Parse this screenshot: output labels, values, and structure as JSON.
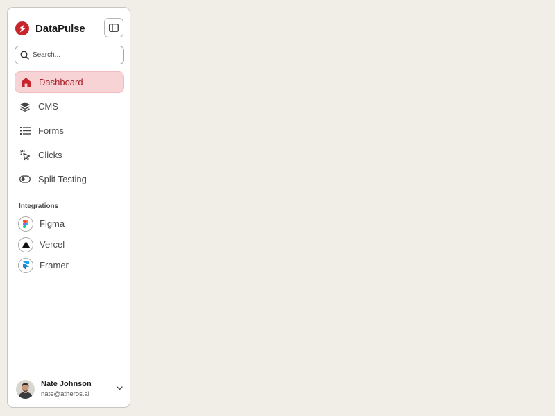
{
  "brand": {
    "name": "DataPulse",
    "logo_icon": "bolt-icon",
    "accent_color": "#c8242b"
  },
  "sidebar": {
    "collapse_icon": "sidebar-toggle-icon",
    "search": {
      "placeholder": "Search...",
      "value": "",
      "icon": "search-icon"
    },
    "nav_items": [
      {
        "label": "Dashboard",
        "icon": "home-icon",
        "active": true
      },
      {
        "label": "CMS",
        "icon": "layers-icon",
        "active": false
      },
      {
        "label": "Forms",
        "icon": "list-icon",
        "active": false
      },
      {
        "label": "Clicks",
        "icon": "cursor-click-icon",
        "active": false
      },
      {
        "label": "Split Testing",
        "icon": "toggle-icon",
        "active": false
      }
    ],
    "integrations_title": "Integrations",
    "integrations": [
      {
        "label": "Figma",
        "icon": "figma-icon"
      },
      {
        "label": "Vercel",
        "icon": "vercel-icon"
      },
      {
        "label": "Framer",
        "icon": "framer-icon"
      }
    ]
  },
  "user": {
    "name": "Nate Johnson",
    "email": "nate@atheros.ai",
    "avatar_icon": "avatar",
    "menu_icon": "chevron-down-icon"
  },
  "colors": {
    "background": "#f1eee8",
    "active_bg": "#f7d3d6",
    "active_text": "#a81e24"
  }
}
